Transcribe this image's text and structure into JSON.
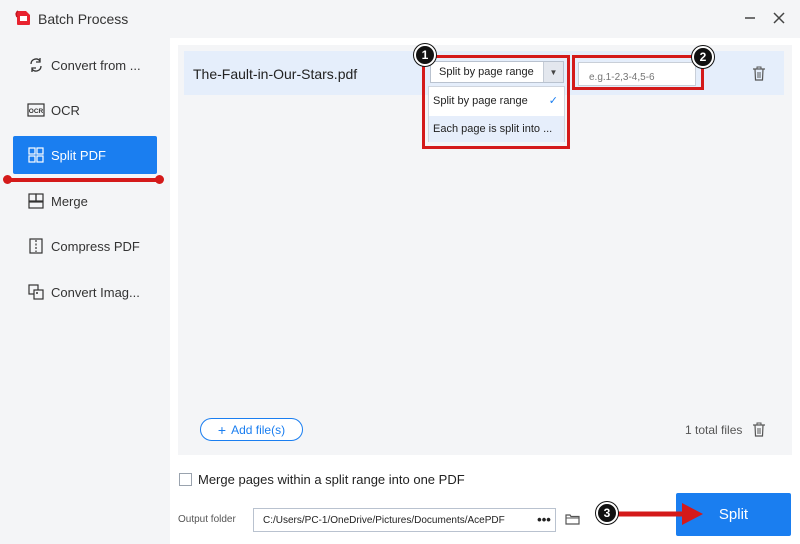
{
  "window": {
    "title": "Batch Process",
    "minimize_icon": "minimize-icon",
    "close_icon": "close-icon"
  },
  "sidebar": {
    "items": [
      {
        "label": "Convert from ...",
        "icon": "convert-icon"
      },
      {
        "label": "OCR",
        "icon": "ocr-icon"
      },
      {
        "label": "Split PDF",
        "icon": "split-icon",
        "active": true
      },
      {
        "label": "Merge",
        "icon": "merge-icon"
      },
      {
        "label": "Compress PDF",
        "icon": "compress-icon"
      },
      {
        "label": "Convert Imag...",
        "icon": "convert-image-icon"
      }
    ]
  },
  "file_list": {
    "files": [
      {
        "name": "The-Fault-in-Our-Stars.pdf"
      }
    ],
    "split_mode": {
      "selected": "Split by page range",
      "options": [
        "Split by page range",
        "Each page is split into ..."
      ]
    },
    "range_placeholder": "e.g.1-2,3-4,5-6"
  },
  "footer": {
    "add_files_label": "Add file(s)",
    "total_files": "1 total files",
    "merge_checkbox_label": "Merge pages within a split range into one PDF",
    "merge_checked": false,
    "output_folder_label": "Output folder",
    "output_path": "C:/Users/PC-1/OneDrive/Pictures/Documents/AcePDF",
    "browse_label": "•••",
    "split_label": "Split"
  },
  "annotations": {
    "badges": [
      "1",
      "2",
      "3"
    ]
  },
  "colors": {
    "accent": "#1a7ef0",
    "highlight_red": "#d41a1a",
    "sidebar_bg": "#f4f5f7",
    "row_bg": "#e5eefb"
  }
}
